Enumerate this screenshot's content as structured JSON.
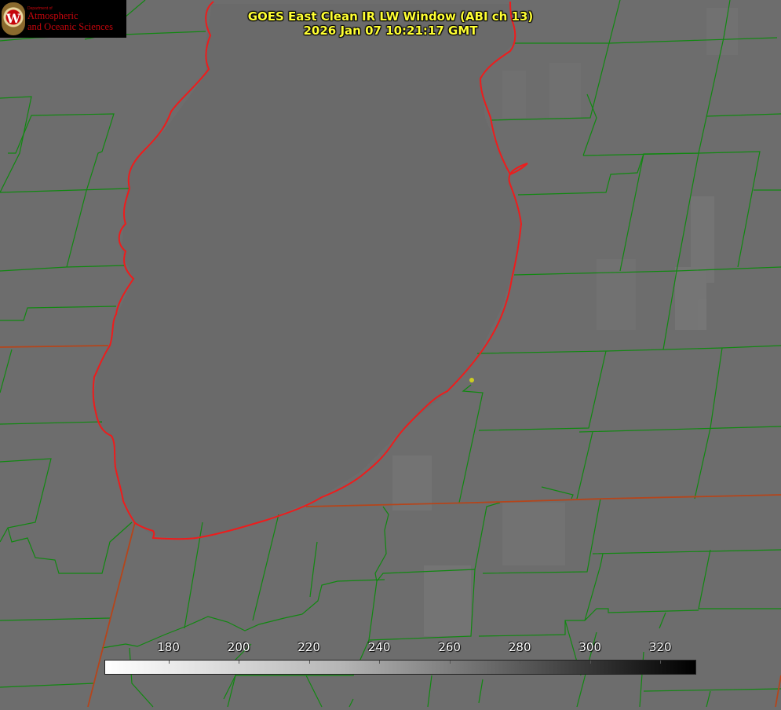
{
  "title": {
    "line1": "GOES East Clean IR LW Window (ABI ch 13)",
    "line2": "2026 Jan 07 10:21:17 GMT"
  },
  "logo": {
    "small": "Department of",
    "line1": "Atmospheric",
    "line2": "and Oceanic Sciences",
    "seal_letter": "W"
  },
  "colorbar": {
    "ticks": [
      "180",
      "200",
      "220",
      "240",
      "260",
      "280",
      "300",
      "320"
    ],
    "tick_values": [
      180,
      200,
      220,
      240,
      260,
      280,
      300,
      320
    ],
    "range": [
      162,
      330
    ],
    "colormap": "white-to-black grayscale"
  },
  "colors": {
    "background": "#6d6d6d",
    "title": "#ffff33",
    "county_lines": "#118811",
    "state_lines": "#b5451b",
    "coastline": "#ee1c1c",
    "marker": "#cccc22"
  },
  "map_layers": [
    "county-boundaries",
    "state-boundaries",
    "lake-coastline",
    "location-marker"
  ]
}
